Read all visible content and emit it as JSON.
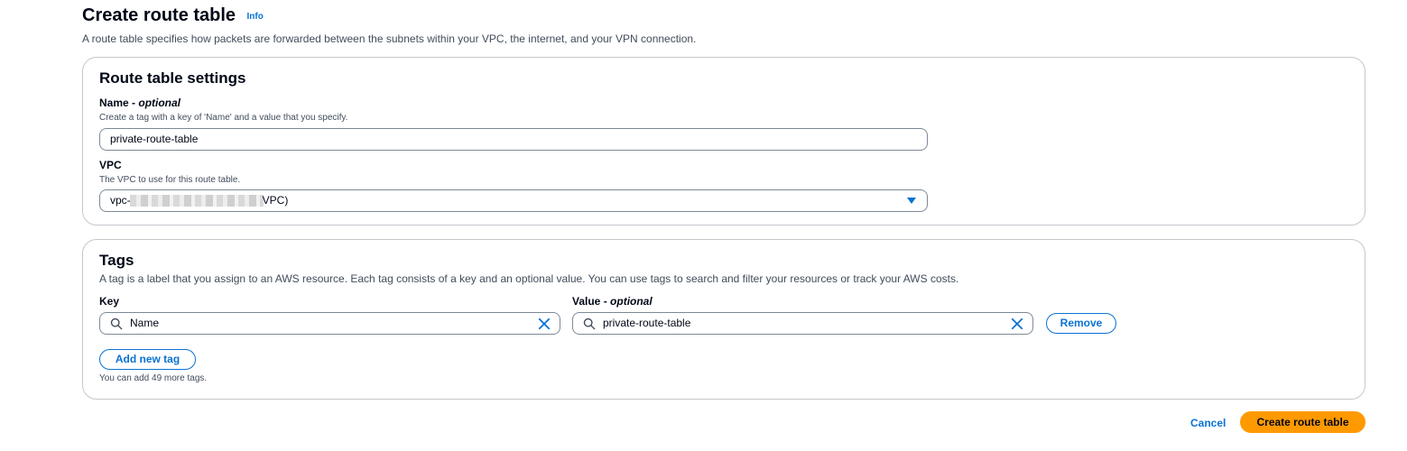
{
  "header": {
    "title": "Create route table",
    "info_label": "Info",
    "description": "A route table specifies how packets are forwarded between the subnets within your VPC, the internet, and your VPN connection."
  },
  "settings": {
    "heading": "Route table settings",
    "name": {
      "label": "Name - ",
      "label_optional": "optional",
      "hint": "Create a tag with a key of 'Name' and a value that you specify.",
      "value": "private-route-table"
    },
    "vpc": {
      "label": "VPC",
      "hint": "The VPC to use for this route table.",
      "value_prefix": "vpc-",
      "value_suffix": "VPC)"
    }
  },
  "tags": {
    "heading": "Tags",
    "description": "A tag is a label that you assign to an AWS resource. Each tag consists of a key and an optional value. You can use tags to search and filter your resources or track your AWS costs.",
    "key_label": "Key",
    "value_label": "Value - ",
    "value_label_optional": "optional",
    "rows": [
      {
        "key": "Name",
        "value": "private-route-table",
        "remove_label": "Remove"
      }
    ],
    "add_label": "Add new tag",
    "limit_text": "You can add 49 more tags."
  },
  "footer": {
    "cancel_label": "Cancel",
    "submit_label": "Create route table"
  },
  "colors": {
    "accent": "#0972d3",
    "primary_button": "#ff9900",
    "border": "#c6c6cd"
  }
}
